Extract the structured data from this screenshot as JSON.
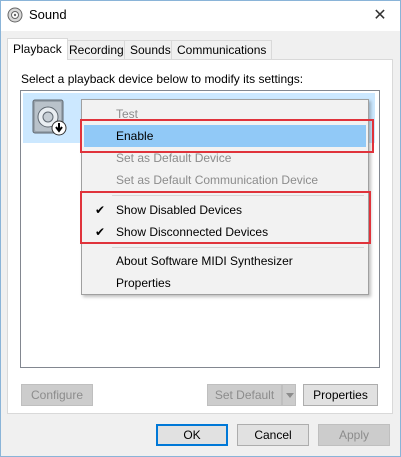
{
  "window": {
    "title": "Sound",
    "close_glyph": "✕",
    "icon": "speaker-icon"
  },
  "tabs": [
    {
      "label": "Playback",
      "active": true
    },
    {
      "label": "Recording",
      "active": false
    },
    {
      "label": "Sounds",
      "active": false
    },
    {
      "label": "Communications",
      "active": false
    }
  ],
  "instruction": "Select a playback device below to modify its settings:",
  "context_menu": {
    "items": [
      {
        "label": "Test",
        "disabled": true,
        "checked": false,
        "highlighted": false
      },
      {
        "label": "Enable",
        "disabled": false,
        "checked": false,
        "highlighted": true
      },
      {
        "label": "Set as Default Device",
        "disabled": true,
        "checked": false,
        "highlighted": false
      },
      {
        "label": "Set as Default Communication Device",
        "disabled": true,
        "checked": false,
        "highlighted": false
      },
      {
        "label": "Show Disabled Devices",
        "disabled": false,
        "checked": true,
        "highlighted": false
      },
      {
        "label": "Show Disconnected Devices",
        "disabled": false,
        "checked": true,
        "highlighted": false
      },
      {
        "label": "About Software MIDI Synthesizer",
        "disabled": false,
        "checked": false,
        "highlighted": false
      },
      {
        "label": "Properties",
        "disabled": false,
        "checked": false,
        "highlighted": false
      }
    ],
    "check_glyph": "✔"
  },
  "panel_buttons": {
    "configure": "Configure",
    "set_default": "Set Default",
    "properties": "Properties"
  },
  "dialog_buttons": {
    "ok": "OK",
    "cancel": "Cancel",
    "apply": "Apply"
  },
  "colors": {
    "highlight": "#91c9f7",
    "selection": "#cce8ff",
    "annotation_red": "#e0333b"
  }
}
